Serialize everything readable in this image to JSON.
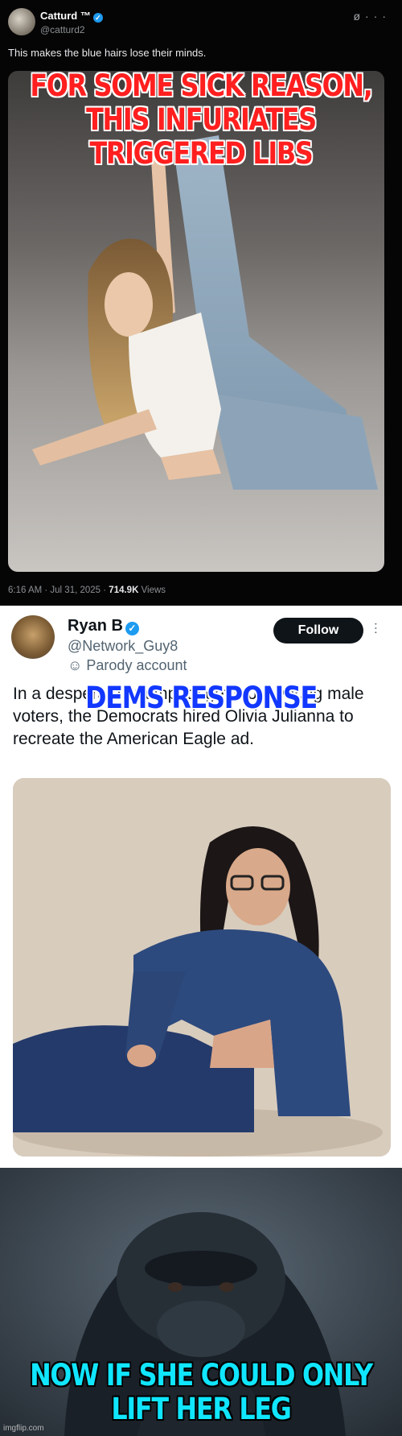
{
  "colors": {
    "caption_red": "#ff1f1f",
    "caption_blue": "#1238ff",
    "caption_cyan": "#10e6ff",
    "x_verified": "#1d9bf0"
  },
  "panel1": {
    "name": "Catturd ™",
    "handle": "@catturd2",
    "icons": [
      "grok-icon",
      "more-icon"
    ],
    "text": "This makes the blue hairs lose their minds.",
    "caption": "FOR SOME SICK REASON, THIS INFURIATES TRIGGERED LIBS",
    "time": "6:16 AM · Jul 31, 2025 · ",
    "views_count": "714.9K",
    "views_label": " Views"
  },
  "panel2": {
    "name": "Ryan B",
    "handle": "@Network_Guy8",
    "parody": "Parody account",
    "follow": "Follow",
    "text": "In a desperate attempt to get more young male voters, the Democrats hired Olivia Julianna to recreate the American Eagle ad.",
    "caption": "DEMS RESPONSE"
  },
  "panel3": {
    "caption": "NOW IF SHE COULD ONLY LIFT HER LEG",
    "watermark": "imgflip.com"
  }
}
